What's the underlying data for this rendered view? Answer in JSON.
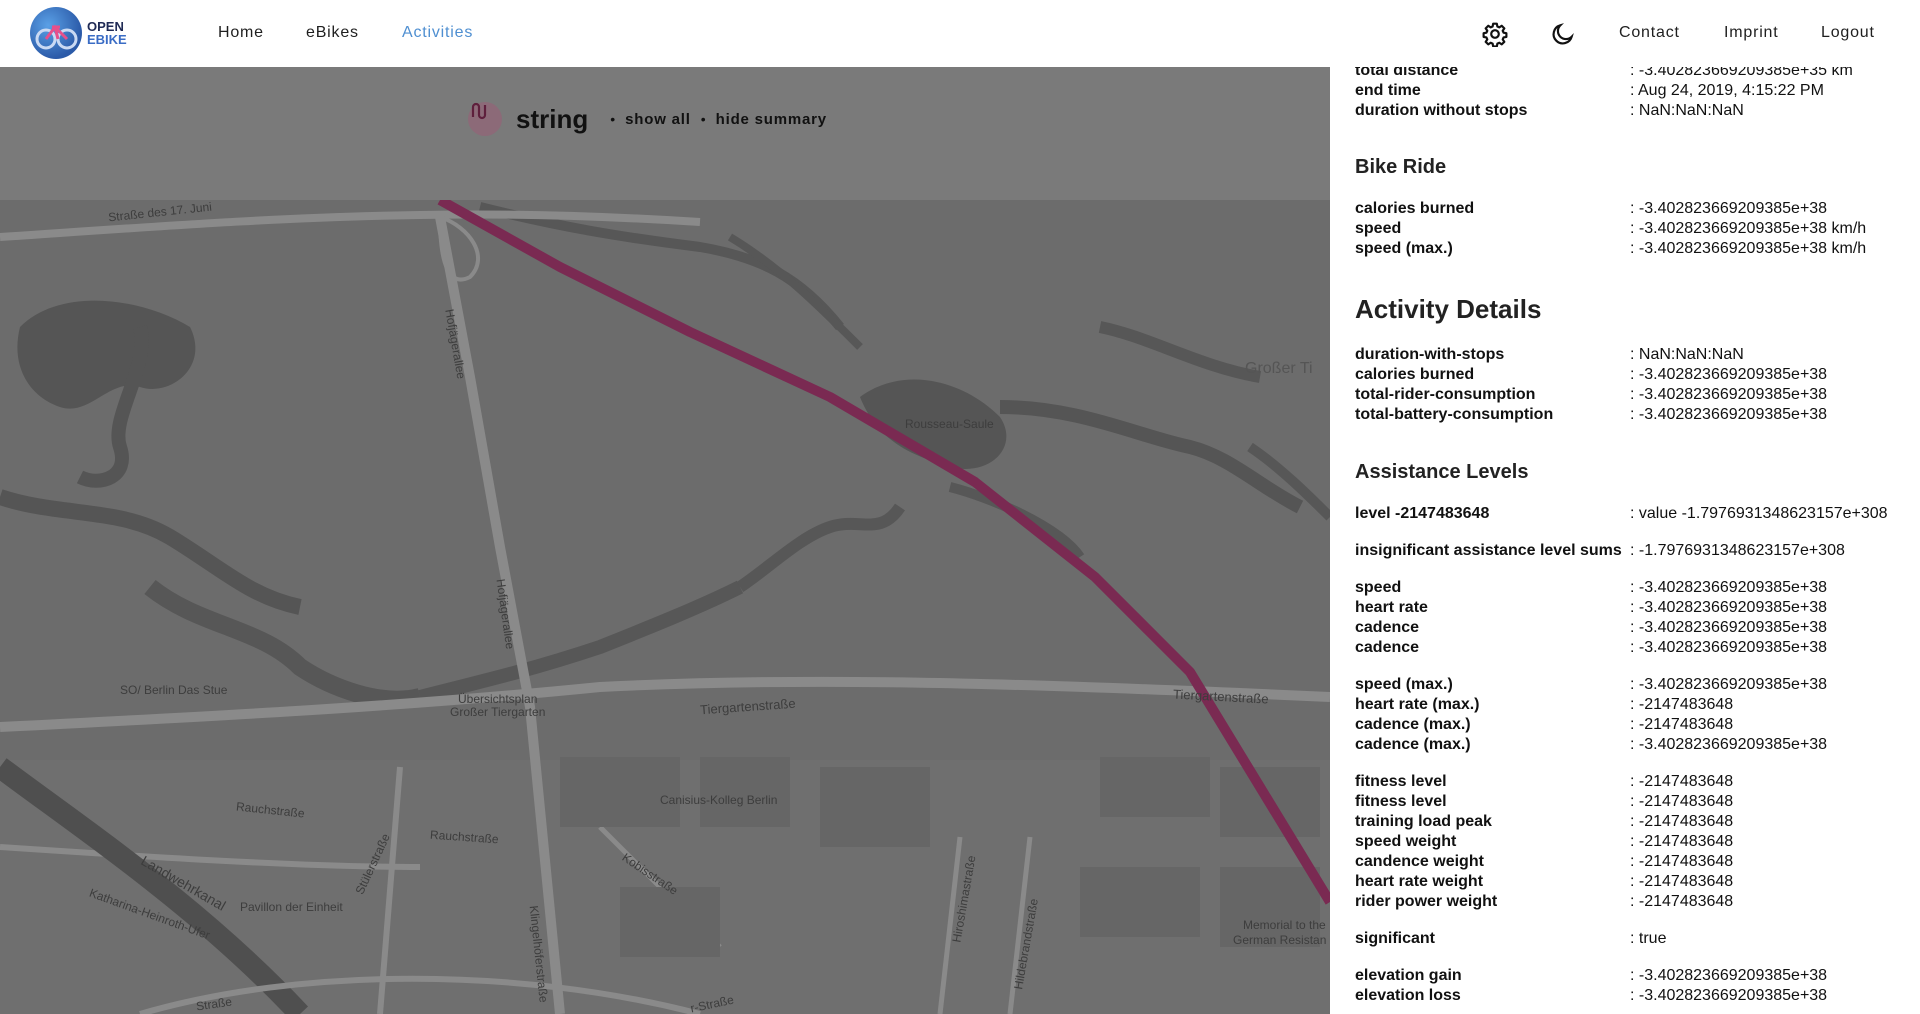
{
  "header": {
    "logo_line1": "OPEN",
    "logo_line2": "EBIKE",
    "nav": [
      {
        "label": "Home"
      },
      {
        "label": "eBikes"
      },
      {
        "label": "Activities"
      }
    ],
    "active_nav": "Activities",
    "settings_icon": "gear-icon",
    "theme_icon": "moon-icon",
    "links": [
      {
        "label": "Contact"
      },
      {
        "label": "Imprint"
      },
      {
        "label": "Logout"
      }
    ]
  },
  "map": {
    "route_icon": "route-icon",
    "activity_name": "string",
    "dot": "•",
    "show_all": "show all",
    "hide_summary": "hide summary",
    "route_color": "#7a2a52",
    "labels": [
      "Straße des 17. Juni",
      "Hofjägerallee",
      "Hofjägerallee",
      "Rousseau-Saule",
      "Großer Ti",
      "SO/ Berlin Das Stue",
      "Übersichtsplan",
      "Großer Tiergarten",
      "Tiergartenstraße",
      "Tiergartenstraße",
      "Canisius-Kolleg Berlin",
      "Rauchstraße",
      "Rauchstraße",
      "Stülerstraße",
      "Kobisstraße",
      "Landwehrkanal",
      "Katharina-Heinroth-Ufer",
      "Pavillon der Einheit",
      "Klingelhöferstraße",
      "Hiroshimastraße",
      "Hildebrandstraße",
      "Memorial to the",
      "German Resistan",
      "Straße",
      "r-Straße"
    ]
  },
  "panel": {
    "top_rows": [
      {
        "key": "total distance",
        "value": ": -3.402823669209385e+35 km"
      },
      {
        "key": "end time",
        "value": ": Aug 24, 2019, 4:15:22 PM"
      },
      {
        "key": "duration without stops",
        "value": ": NaN:NaN:NaN"
      }
    ],
    "bike_ride": {
      "title": "Bike Ride",
      "rows": [
        {
          "key": "calories burned",
          "value": ": -3.402823669209385e+38"
        },
        {
          "key": "speed",
          "value": ": -3.402823669209385e+38 km/h"
        },
        {
          "key": "speed (max.)",
          "value": ": -3.402823669209385e+38 km/h"
        }
      ]
    },
    "activity_details": {
      "title": "Activity Details",
      "rows": [
        {
          "key": "duration-with-stops",
          "value": ": NaN:NaN:NaN"
        },
        {
          "key": "calories burned",
          "value": ": -3.402823669209385e+38"
        },
        {
          "key": "total-rider-consumption",
          "value": ": -3.402823669209385e+38"
        },
        {
          "key": "total-battery-consumption",
          "value": ": -3.402823669209385e+38"
        }
      ]
    },
    "assistance_levels": {
      "title": "Assistance Levels",
      "level_row": {
        "key": "level -2147483648",
        "value": ": value -1.7976931348623157e+308"
      },
      "insig_row": {
        "key": "insignificant assistance level sums",
        "value": ": -1.7976931348623157e+308"
      },
      "avg_rows": [
        {
          "key": "speed",
          "value": ": -3.402823669209385e+38"
        },
        {
          "key": "heart rate",
          "value": ": -3.402823669209385e+38"
        },
        {
          "key": "cadence",
          "value": ": -3.402823669209385e+38"
        },
        {
          "key": "cadence",
          "value": ": -3.402823669209385e+38"
        }
      ],
      "max_rows": [
        {
          "key": "speed (max.)",
          "value": ": -3.402823669209385e+38"
        },
        {
          "key": "heart rate (max.)",
          "value": ": -2147483648"
        },
        {
          "key": "cadence (max.)",
          "value": ": -2147483648"
        },
        {
          "key": "cadence (max.)",
          "value": ": -3.402823669209385e+38"
        }
      ],
      "fitness_rows": [
        {
          "key": "fitness level",
          "value": ": -2147483648"
        },
        {
          "key": "fitness level",
          "value": ": -2147483648"
        },
        {
          "key": "training load peak",
          "value": ": -2147483648"
        },
        {
          "key": "speed weight",
          "value": ": -2147483648"
        },
        {
          "key": "candence weight",
          "value": ": -2147483648"
        },
        {
          "key": "heart rate weight",
          "value": ": -2147483648"
        },
        {
          "key": "rider power weight",
          "value": ": -2147483648"
        }
      ],
      "significant_row": {
        "key": "significant",
        "value": ": true"
      },
      "elevation_rows": [
        {
          "key": "elevation gain",
          "value": ": -3.402823669209385e+38"
        },
        {
          "key": "elevation loss",
          "value": ": -3.402823669209385e+38"
        }
      ]
    }
  }
}
